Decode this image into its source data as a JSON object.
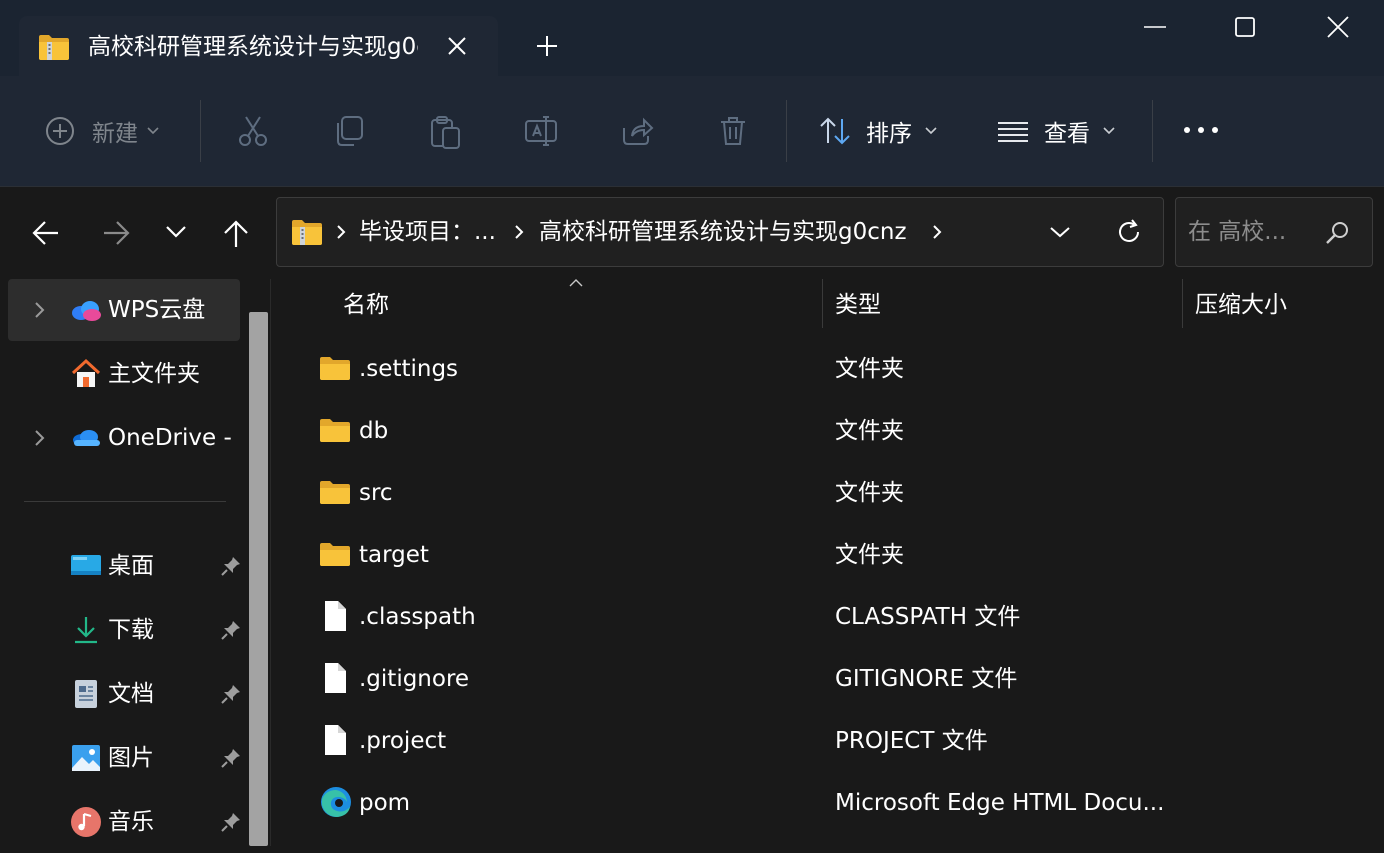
{
  "tab": {
    "title": "高校科研管理系统设计与实现g0cnz"
  },
  "toolbar": {
    "new_label": "新建",
    "sort_label": "排序",
    "view_label": "查看"
  },
  "address": {
    "segment1": "毕设项目：...",
    "segment2": "高校科研管理系统设计与实现g0cnz"
  },
  "search": {
    "placeholder": "在 高校..."
  },
  "sidebar": {
    "items": [
      {
        "label": "WPS云盘",
        "icon": "wps-cloud-icon",
        "expandable": true,
        "selected": true
      },
      {
        "label": "主文件夹",
        "icon": "home-icon",
        "expandable": false
      },
      {
        "label": "OneDrive -",
        "icon": "onedrive-icon",
        "expandable": true
      },
      {
        "label": "桌面",
        "icon": "desktop-icon",
        "pinned": true
      },
      {
        "label": "下载",
        "icon": "download-icon",
        "pinned": true
      },
      {
        "label": "文档",
        "icon": "documents-icon",
        "pinned": true
      },
      {
        "label": "图片",
        "icon": "pictures-icon",
        "pinned": true
      },
      {
        "label": "音乐",
        "icon": "music-icon",
        "pinned": true
      }
    ]
  },
  "columns": {
    "name": "名称",
    "type": "类型",
    "compressed_size": "压缩大小"
  },
  "files": [
    {
      "name": ".settings",
      "type": "文件夹",
      "icon": "folder-icon"
    },
    {
      "name": "db",
      "type": "文件夹",
      "icon": "folder-icon"
    },
    {
      "name": "src",
      "type": "文件夹",
      "icon": "folder-icon"
    },
    {
      "name": "target",
      "type": "文件夹",
      "icon": "folder-icon"
    },
    {
      "name": ".classpath",
      "type": "CLASSPATH 文件",
      "icon": "file-icon"
    },
    {
      "name": ".gitignore",
      "type": "GITIGNORE 文件",
      "icon": "file-icon"
    },
    {
      "name": ".project",
      "type": "PROJECT 文件",
      "icon": "file-icon"
    },
    {
      "name": "pom",
      "type": "Microsoft Edge HTML Docu...",
      "icon": "edge-icon"
    }
  ],
  "colors": {
    "titlebar": "#1b2431",
    "commandbar": "#1f2734",
    "background": "#191919",
    "folder": "#f8c33a"
  }
}
